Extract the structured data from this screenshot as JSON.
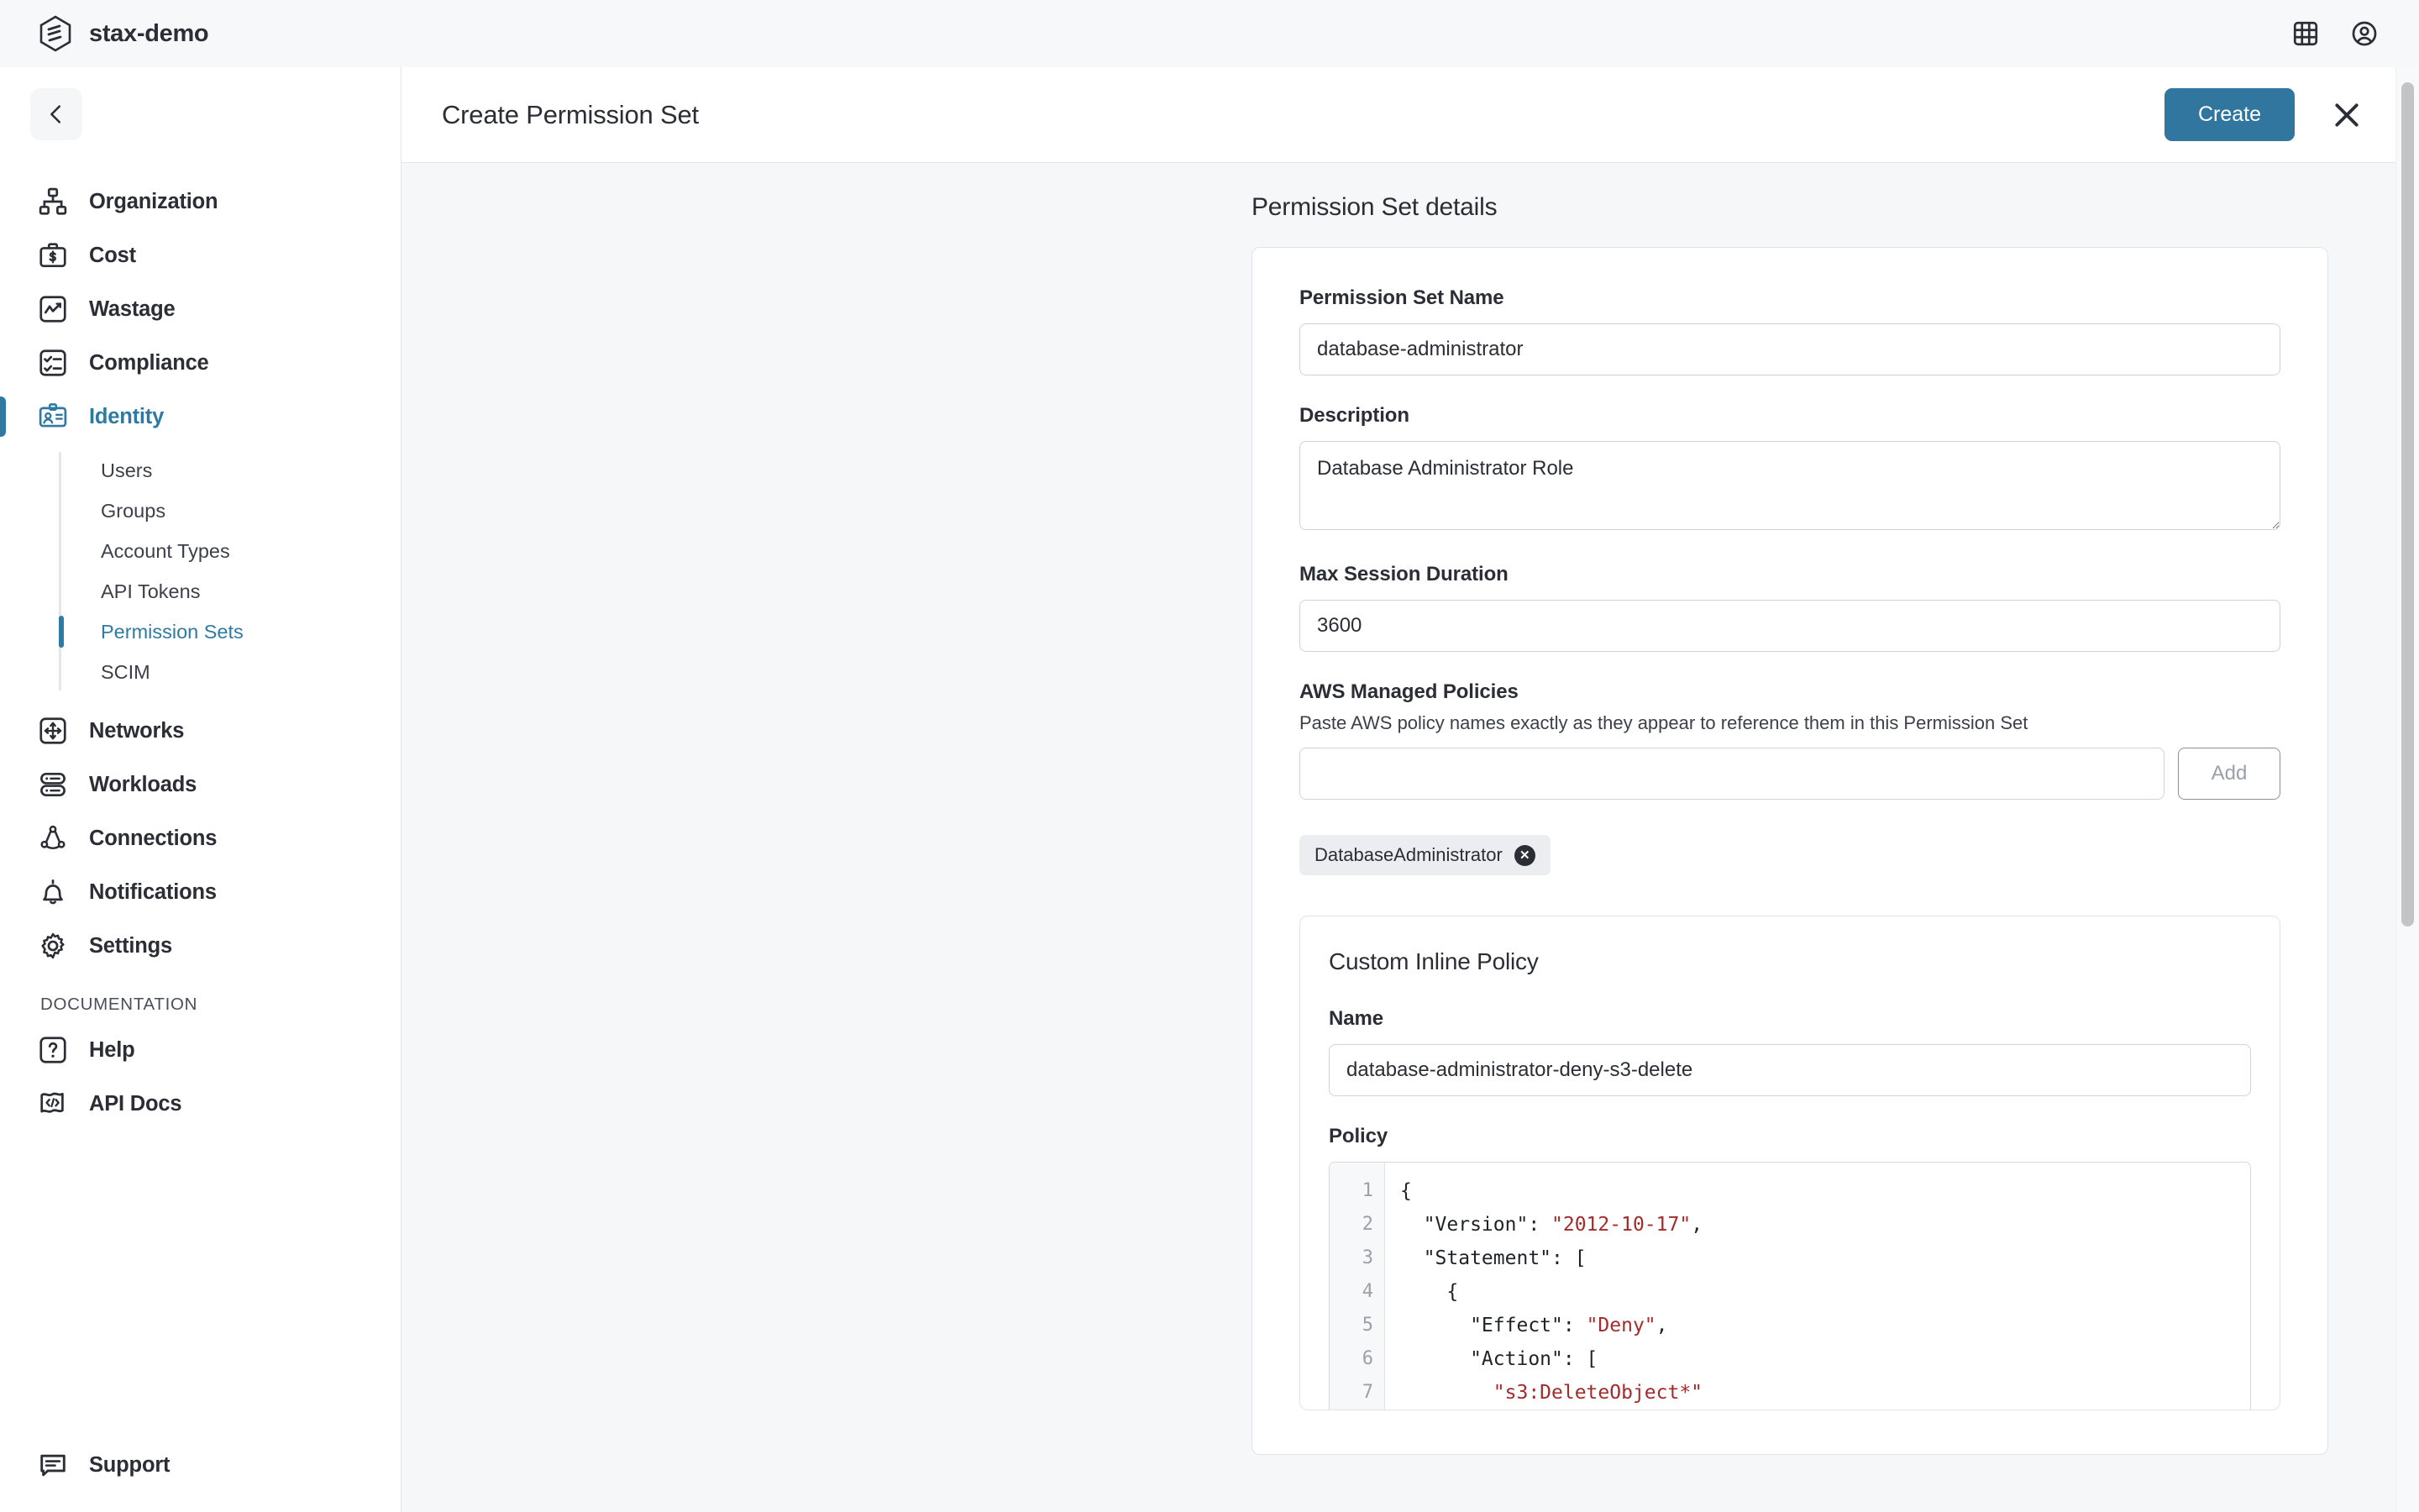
{
  "topbar": {
    "org_name": "stax-demo",
    "logo_icon": "stax-hexagon-logo",
    "apps_icon": "grid-apps-icon",
    "account_icon": "user-circle-icon"
  },
  "sidebar": {
    "collapse_icon": "chevron-left-icon",
    "items": [
      {
        "label": "Organization",
        "icon": "org-chart-icon",
        "active": false
      },
      {
        "label": "Cost",
        "icon": "briefcase-dollar-icon",
        "active": false
      },
      {
        "label": "Wastage",
        "icon": "chart-line-square-icon",
        "active": false
      },
      {
        "label": "Compliance",
        "icon": "checklist-icon",
        "active": false
      },
      {
        "label": "Identity",
        "icon": "id-card-icon",
        "active": true
      }
    ],
    "subitems": [
      {
        "label": "Users",
        "active": false
      },
      {
        "label": "Groups",
        "active": false
      },
      {
        "label": "Account Types",
        "active": false
      },
      {
        "label": "API Tokens",
        "active": false
      },
      {
        "label": "Permission Sets",
        "active": true
      },
      {
        "label": "SCIM",
        "active": false
      }
    ],
    "items2": [
      {
        "label": "Networks",
        "icon": "arrows-move-square-icon",
        "active": false
      },
      {
        "label": "Workloads",
        "icon": "server-stack-icon",
        "active": false
      },
      {
        "label": "Connections",
        "icon": "network-nodes-icon",
        "active": false
      },
      {
        "label": "Notifications",
        "icon": "bell-icon",
        "active": false
      },
      {
        "label": "Settings",
        "icon": "gear-icon",
        "active": false
      }
    ],
    "section_title": "DOCUMENTATION",
    "docs_items": [
      {
        "label": "Help",
        "icon": "question-square-icon",
        "active": false
      },
      {
        "label": "API Docs",
        "icon": "code-flag-icon",
        "active": false
      }
    ],
    "support": {
      "label": "Support",
      "icon": "chat-bubble-icon"
    }
  },
  "panel": {
    "title": "Create Permission Set",
    "create_label": "Create",
    "close_icon": "close-x-icon",
    "accent_color": "#31769e"
  },
  "form": {
    "section_heading": "Permission Set details",
    "name": {
      "label": "Permission Set Name",
      "value": "database-administrator",
      "placeholder": ""
    },
    "description": {
      "label": "Description",
      "value": "Database Administrator Role",
      "placeholder": ""
    },
    "max_session_duration": {
      "label": "Max Session Duration",
      "value": "3600",
      "placeholder": ""
    },
    "aws_managed_policies": {
      "label": "AWS Managed Policies",
      "help": "Paste AWS policy names exactly as they appear to reference them in this Permission Set",
      "input_value": "",
      "placeholder": "",
      "add_label": "Add",
      "chips": [
        {
          "label": "DatabaseAdministrator",
          "remove_icon": "remove-chip-icon"
        }
      ]
    },
    "custom_inline_policy": {
      "title": "Custom Inline Policy",
      "name_label": "Name",
      "name_value": "database-administrator-deny-s3-delete",
      "policy_label": "Policy",
      "editor": {
        "line_numbers": [
          "1",
          "2",
          "3",
          "4",
          "5",
          "6",
          "7"
        ],
        "lines": [
          [
            {
              "t": "{",
              "c": "plain"
            }
          ],
          [
            {
              "t": "  \"Version\": ",
              "c": "plain"
            },
            {
              "t": "\"2012-10-17\"",
              "c": "str"
            },
            {
              "t": ",",
              "c": "plain"
            }
          ],
          [
            {
              "t": "  \"Statement\": [",
              "c": "plain"
            }
          ],
          [
            {
              "t": "    {",
              "c": "plain"
            }
          ],
          [
            {
              "t": "      \"Effect\": ",
              "c": "plain"
            },
            {
              "t": "\"Deny\"",
              "c": "str"
            },
            {
              "t": ",",
              "c": "plain"
            }
          ],
          [
            {
              "t": "      \"Action\": [",
              "c": "plain"
            }
          ],
          [
            {
              "t": "        ",
              "c": "plain"
            },
            {
              "t": "\"s3:DeleteObject*\"",
              "c": "str"
            }
          ]
        ],
        "string_color": "#a22b2b",
        "plain_color": "#1f2227",
        "gutter_color": "#9ba1a8"
      }
    }
  },
  "scrollbar": {
    "name": "main-vertical-scrollbar"
  }
}
